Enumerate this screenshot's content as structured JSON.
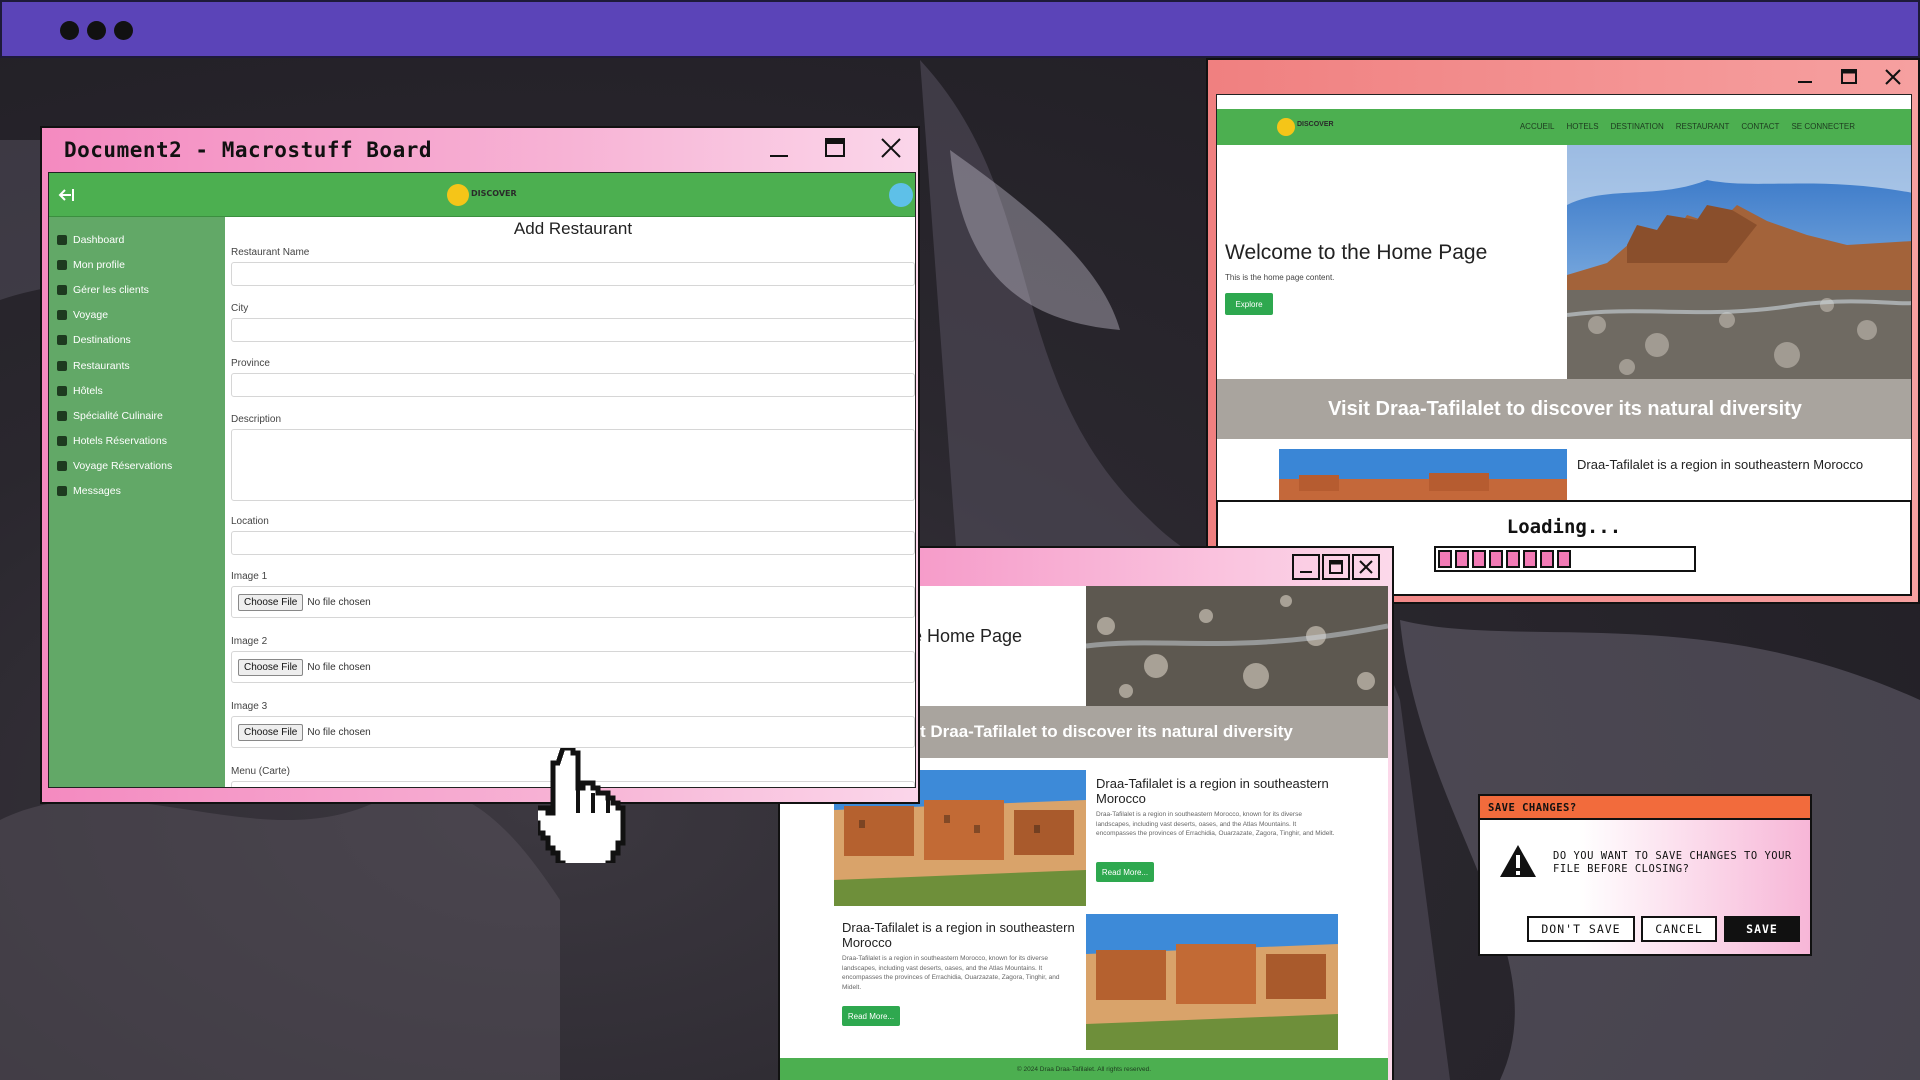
{
  "colors": {
    "accent_purple": "#5b44b8",
    "site_green": "#4caf50",
    "sidebar_green": "#62a867",
    "window_pink": "#f48ac0",
    "dialog_orange": "#f26b3c",
    "progress_pink": "#f27ab5"
  },
  "doc_window": {
    "title": "Document2 - Macrostuff Board"
  },
  "admin": {
    "logo": "DISCOVER",
    "sidebar": [
      {
        "label": "Dashboard",
        "icon": "dashboard-icon"
      },
      {
        "label": "Mon profile",
        "icon": "user-icon"
      },
      {
        "label": "Gérer les clients",
        "icon": "users-icon"
      },
      {
        "label": "Voyage",
        "icon": "plane-icon"
      },
      {
        "label": "Destinations",
        "icon": "map-icon"
      },
      {
        "label": "Restaurants",
        "icon": "utensils-icon"
      },
      {
        "label": "Hôtels",
        "icon": "building-icon"
      },
      {
        "label": "Spécialité Culinaire",
        "icon": "dish-icon"
      },
      {
        "label": "Hotels Réservations",
        "icon": "book-icon"
      },
      {
        "label": "Voyage Réservations",
        "icon": "book-icon"
      },
      {
        "label": "Messages",
        "icon": "envelope-icon"
      }
    ],
    "form": {
      "title": "Add Restaurant",
      "labels": {
        "name": "Restaurant Name",
        "city": "City",
        "province": "Province",
        "description": "Description",
        "location": "Location",
        "image1": "Image 1",
        "image2": "Image 2",
        "image3": "Image 3",
        "menu": "Menu (Carte)"
      },
      "choose_file": "Choose File",
      "no_file": "No file chosen"
    }
  },
  "website": {
    "logo": "DISCOVER",
    "nav": [
      "ACCUEIL",
      "HOTELS",
      "DESTINATION",
      "RESTAURANT",
      "CONTACT",
      "SE CONNECTER"
    ],
    "hero_title": "Welcome to the Home Page",
    "hero_sub": "This is the home page content.",
    "explore": "Explore",
    "band": "Visit Draa-Tafilalet to discover its natural diversity",
    "card_title": "Draa-Tafilalet is a region in southeastern Morocco",
    "loading": "Loading...",
    "progress": 0.45
  },
  "front_site": {
    "hero_title_partial": "e Home Page",
    "band_partial": "t Draa-Tafilalet to discover its natural diversity",
    "card1_title": "Draa-Tafilalet is a region in southeastern Morocco",
    "card_text": "Draa-Tafilalet is a region in southeastern Morocco, known for its diverse landscapes, including vast deserts, oases, and the Atlas Mountains. It encompasses the provinces of Errachidia, Ouarzazate, Zagora, Tinghir, and Midelt.",
    "read_more": "Read More...",
    "card2_title": "Draa-Tafilalet is a region in southeastern Morocco",
    "footer": "© 2024 Draa Draa-Tafilalet. All rights reserved."
  },
  "dialog": {
    "title": "SAVE CHANGES?",
    "message": "DO YOU WANT TO SAVE CHANGES TO YOUR FILE BEFORE CLOSING?",
    "dont_save": "DON'T SAVE",
    "cancel": "CANCEL",
    "save": "SAVE"
  }
}
